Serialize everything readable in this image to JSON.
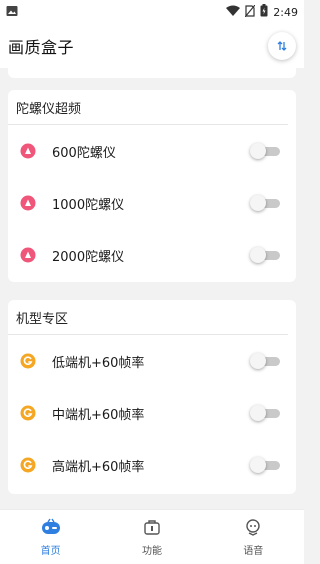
{
  "status_bar": {
    "time": "2:49",
    "icons": [
      "image-icon",
      "wifi-icon",
      "no-sim-icon",
      "battery-icon"
    ]
  },
  "app_bar": {
    "title": "画质盒子",
    "action_icon": "sort-arrows-icon"
  },
  "sections": [
    {
      "title": "陀螺仪超频",
      "icon_color": "#f0567a",
      "items": [
        {
          "label": "600陀螺仪",
          "enabled": false
        },
        {
          "label": "1000陀螺仪",
          "enabled": false
        },
        {
          "label": "2000陀螺仪",
          "enabled": false
        }
      ]
    },
    {
      "title": "机型专区",
      "icon_color": "#f5a623",
      "items": [
        {
          "label": "低端机+60帧率",
          "enabled": false
        },
        {
          "label": "中端机+60帧率",
          "enabled": false
        },
        {
          "label": "高端机+60帧率",
          "enabled": false
        }
      ]
    }
  ],
  "bottom_nav": {
    "items": [
      {
        "label": "首页",
        "icon": "gamepad-icon",
        "active": true
      },
      {
        "label": "功能",
        "icon": "toolbox-icon",
        "active": false
      },
      {
        "label": "语音",
        "icon": "headset-icon",
        "active": false
      }
    ]
  },
  "colors": {
    "accent": "#2f7fe0",
    "toggle_off_track": "#c9c9c9",
    "background": "#f2f2f2"
  }
}
